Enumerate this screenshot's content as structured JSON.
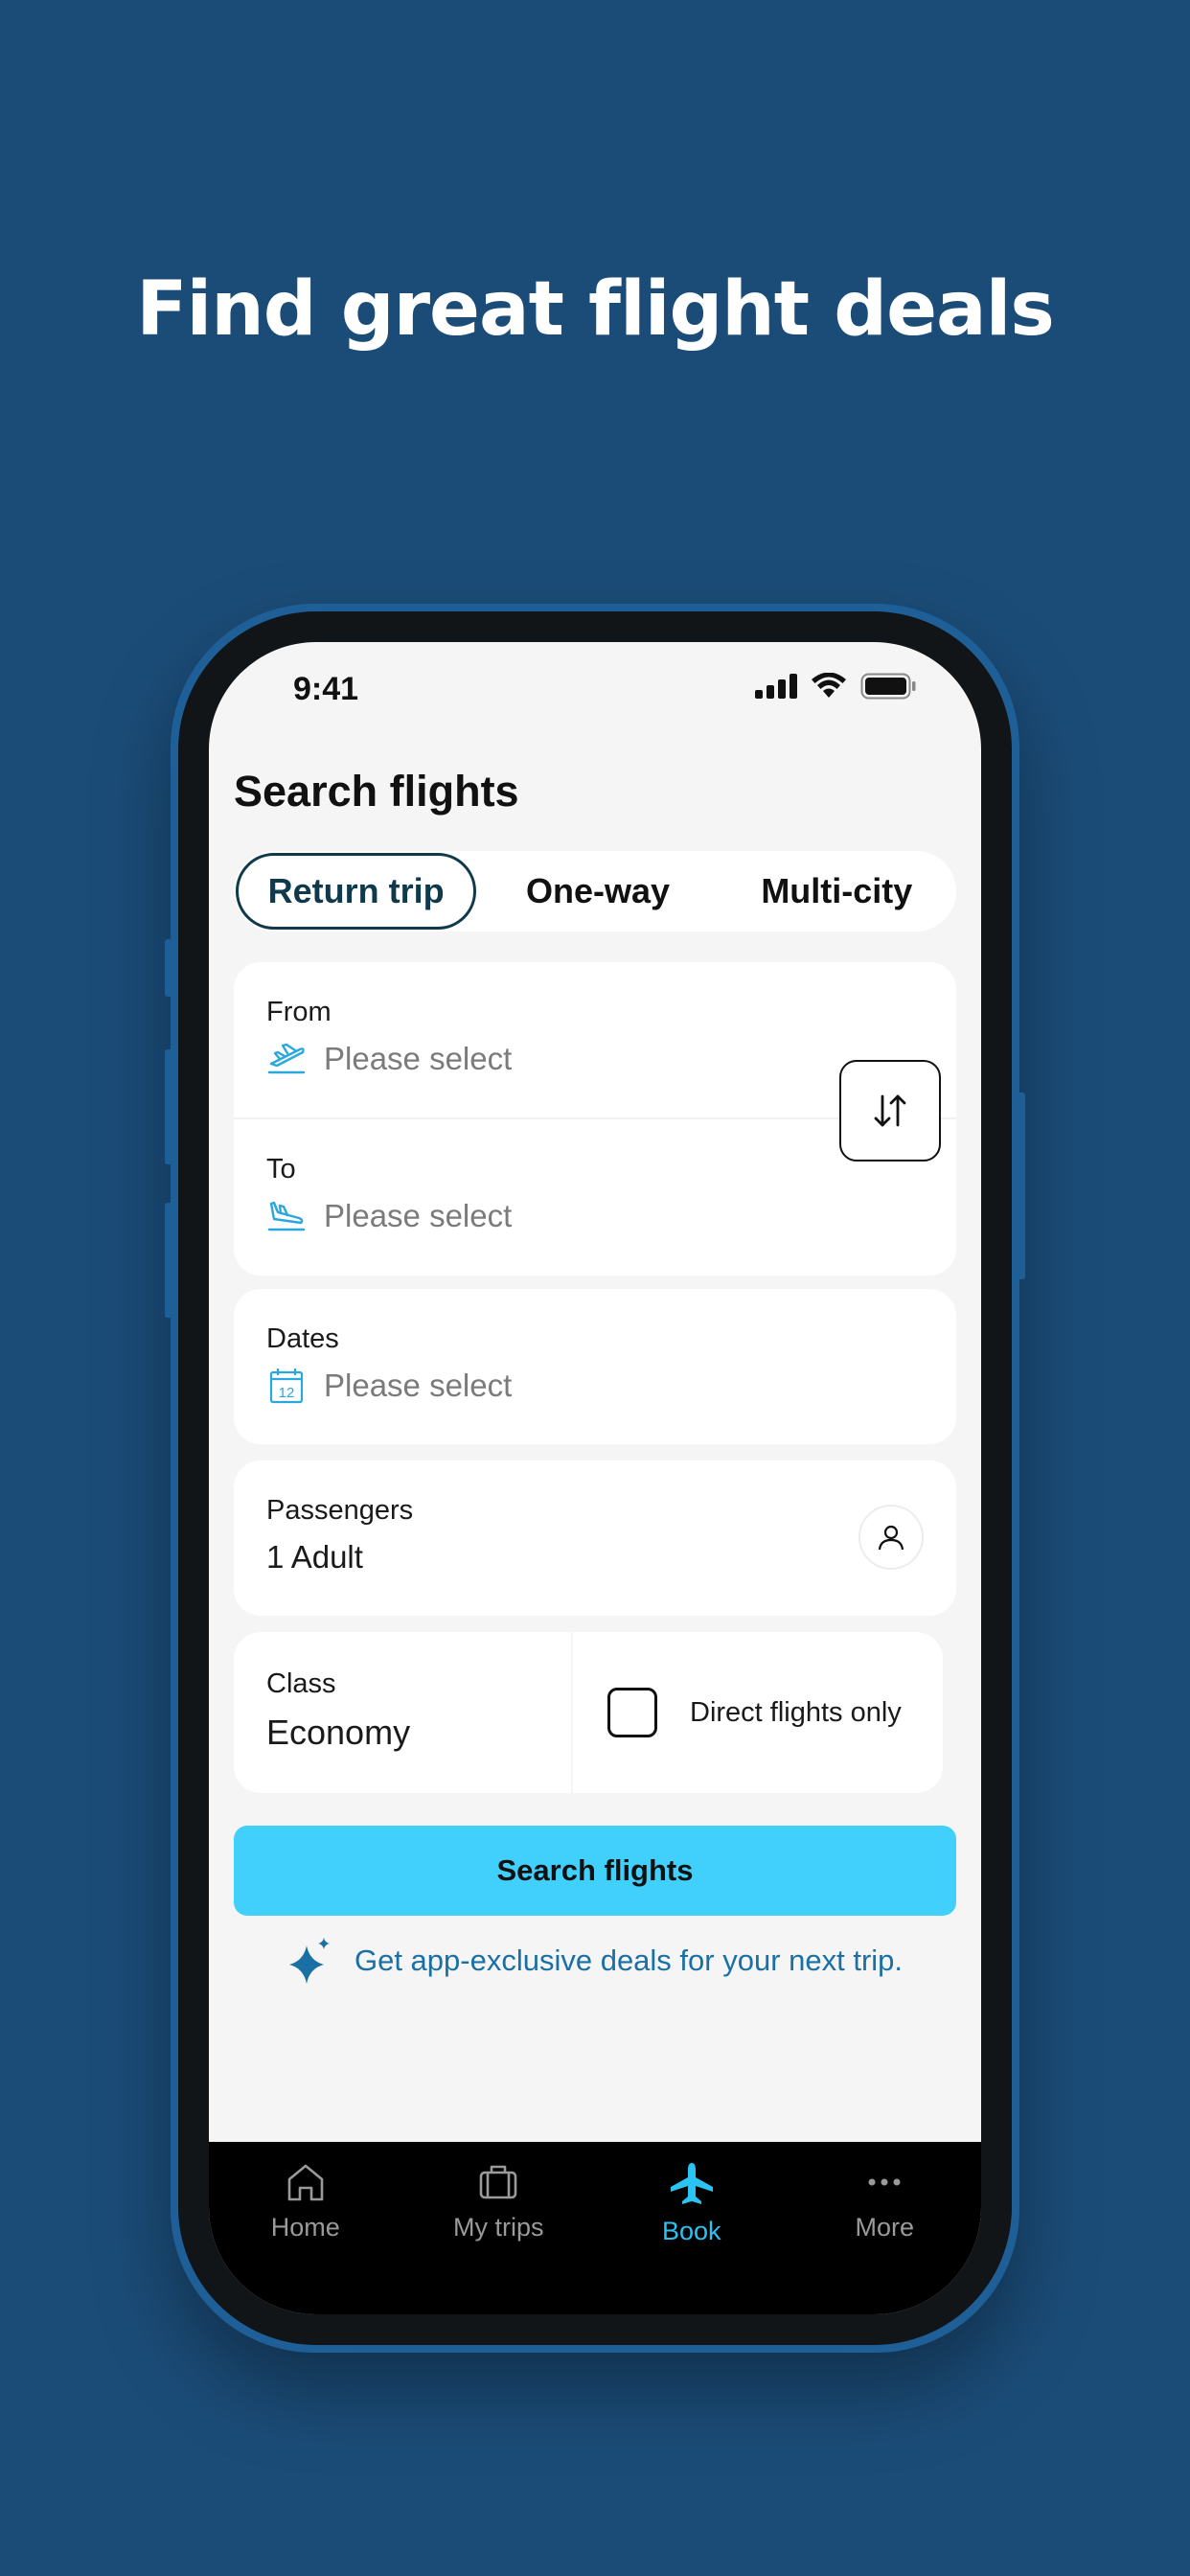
{
  "headline": "Find great flight deals",
  "status_bar": {
    "time": "9:41"
  },
  "screen_title": "Search flights",
  "trip_types": [
    {
      "label": "Return trip",
      "active": true
    },
    {
      "label": "One-way",
      "active": false
    },
    {
      "label": "Multi-city",
      "active": false
    }
  ],
  "from": {
    "label": "From",
    "placeholder": "Please select",
    "icon": "takeoff-icon"
  },
  "to": {
    "label": "To",
    "placeholder": "Please select",
    "icon": "landing-icon"
  },
  "swap": {
    "icon": "swap-arrows-icon"
  },
  "dates": {
    "label": "Dates",
    "placeholder": "Please select",
    "icon": "calendar-icon",
    "icon_text": "12"
  },
  "passengers": {
    "label": "Passengers",
    "value": "1 Adult",
    "icon": "person-icon"
  },
  "class_field": {
    "label": "Class",
    "value": "Economy"
  },
  "direct_flights": {
    "label": "Direct flights only",
    "checked": false
  },
  "search_button": "Search flights",
  "promo_text": "Get app-exclusive deals for your next trip.",
  "tabs": [
    {
      "label": "Home",
      "icon": "home-icon",
      "active": false
    },
    {
      "label": "My trips",
      "icon": "suitcase-icon",
      "active": false
    },
    {
      "label": "Book",
      "icon": "plane-icon",
      "active": true
    },
    {
      "label": "More",
      "icon": "more-dots-icon",
      "active": false
    }
  ],
  "colors": {
    "background": "#1b4c78",
    "accent": "#40d0fb",
    "active_tab": "#2bc3f3",
    "promo": "#1a6fa4",
    "field_icon": "#2aa8dc"
  }
}
